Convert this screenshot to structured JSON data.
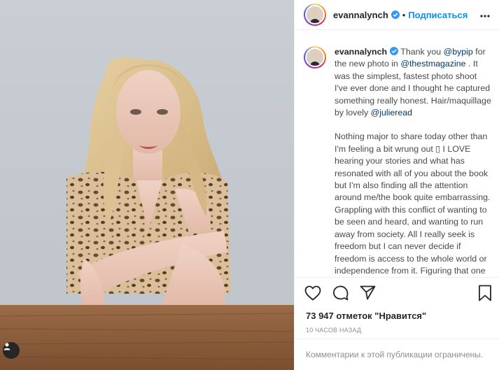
{
  "post": {
    "username": "evannalynch",
    "follow_label": "Подписаться",
    "separator": "•",
    "caption": {
      "intro_text": "Thank you ",
      "mention1": "@bypip",
      "text2": " for the new photo in ",
      "mention2": "@thestmagazine",
      "text3": " . It was the simplest, fastest photo shoot I've ever done and I thought he captured something really honest. Hair/maquillage by lovely ",
      "mention3": "@julieread",
      "paragraph2": "Nothing major to share today other than I'm feeling a bit wrung out ▯ I LOVE hearing your stories and what has resonated with all of you about the book but I'm also finding all the attention around me/the book quite embarrassing. Grappling with this conflict of wanting to be seen and heard, and wanting to run away from society. All I really seek is freedom but I can never decide if freedom is access to the whole world or independence from it. Figuring that one out..."
    },
    "likes_text": "73 947 отметок \"Нравится\"",
    "timestamp": "10 ЧАСОВ НАЗАД",
    "comments_disabled_text": "Комментарии к этой публикации ограничены."
  },
  "icons": {
    "verified": "verified-badge-icon",
    "more": "more-options-icon",
    "like": "heart-icon",
    "comment": "comment-icon",
    "share": "share-icon",
    "save": "bookmark-icon",
    "tag": "user-tag-icon"
  },
  "colors": {
    "accent": "#0095f6",
    "verified": "#3897f0",
    "link": "#00376b",
    "muted": "#8e8e8e"
  }
}
